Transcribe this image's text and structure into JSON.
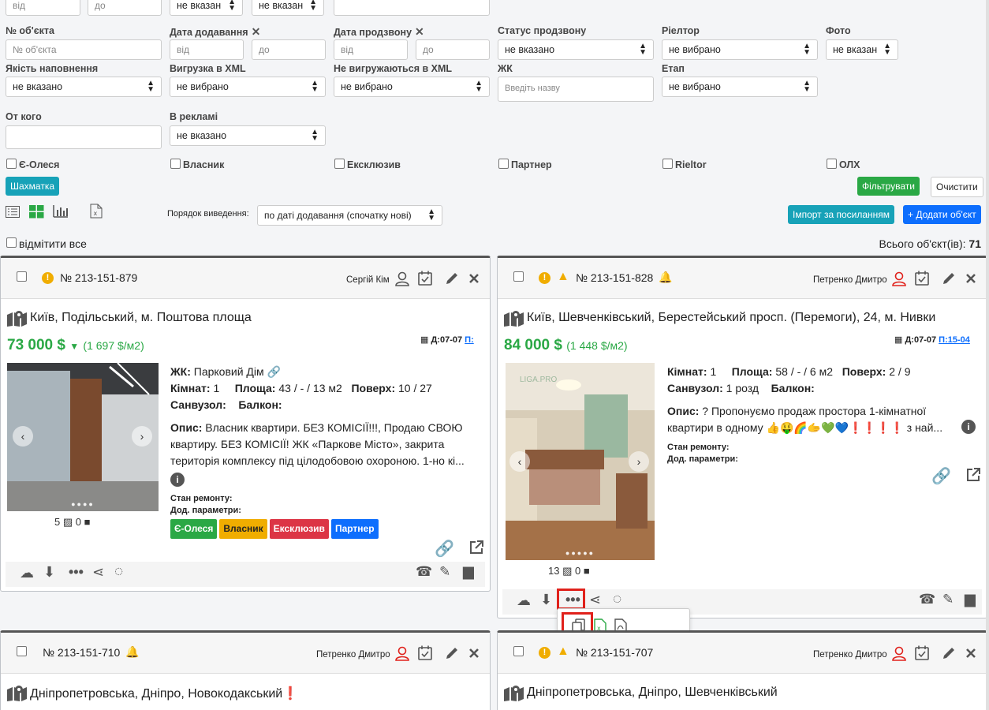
{
  "filters": {
    "row0": {
      "from": "від",
      "to": "до",
      "sel1": "не вказан",
      "sel2": "не вказан"
    },
    "labels": {
      "object_no": "№ об'єкта",
      "date_added": "Дата додавання",
      "date_call": "Дата продзвону",
      "call_status": "Статус продзвону",
      "realtor": "Ріелтор",
      "photo": "Фото",
      "quality": "Якість наповнення",
      "xml_export": "Вигрузка в XML",
      "no_xml": "Не вигружаються в XML",
      "complex": "ЖК",
      "stage": "Етап",
      "from_whom": "От кого",
      "in_ads": "В рекламі"
    },
    "placeholders": {
      "object_no": "№ об'єкта",
      "from": "від",
      "to": "до",
      "complex": "Введіть назву"
    },
    "values": {
      "call_status": "не вказано",
      "realtor": "не вибрано",
      "photo": "не вказан",
      "quality": "не вказано",
      "xml_export": "не вибрано",
      "no_xml": "не вибрано",
      "stage": "не вибрано",
      "in_ads": "не вказано"
    },
    "checkboxes": [
      "Є-Олеся",
      "Власник",
      "Ексклюзив",
      "Партнер",
      "Rieltor",
      "ОЛХ"
    ],
    "chess_btn": "Шахматка",
    "filter_btn": "Фільтрувати",
    "clear_btn": "Очистити"
  },
  "toolbar": {
    "order_label": "Порядок виведення:",
    "order_value": "по даті додавання (спочатку нові)",
    "import_btn": "Імпорт за посиланням",
    "add_btn": "+ Додати об'єкт",
    "mark_all": "відмітити все",
    "total_label": "Всього об'єкт(ів):",
    "total_value": "71"
  },
  "cards": [
    {
      "number": "№ 213-151-879",
      "agent": "Сергій Кім",
      "address": "Київ, Подільський, м. Поштова площа",
      "price": "73 000 $",
      "price_m2": "(1 697 $/м2)",
      "date": "Д:07-07",
      "p_link": "П:",
      "complex_label": "ЖК:",
      "complex": "Парковий Дім",
      "rooms_label": "Кімнат:",
      "rooms": "1",
      "area_label": "Площа:",
      "area": "43 / - / 13 м2",
      "floor_label": "Поверх:",
      "floor": "10 / 27",
      "bath_label": "Санвузол:",
      "balcony_label": "Балкон:",
      "desc_label": "Опис:",
      "desc": "Власник квартири. БЕЗ КОМІСІЇ!!!, Продаю СВОЮ квартиру. БЕЗ КОМІСІЇ! ЖК «Паркове Місто», закрита територія комплексу під цілодобовою охороною. 1-но кі...",
      "repair_label": "Стан ремонту:",
      "params_label": "Дод. параметри:",
      "photos": "5",
      "videos": "0",
      "tags": [
        "Є-Олеся",
        "Власник",
        "Ексклюзив",
        "Партнер"
      ]
    },
    {
      "number": "№ 213-151-828",
      "agent": "Петренко Дмитро",
      "address": "Київ, Шевченківський, Берестейський просп. (Перемоги), 24, м. Нивки",
      "price": "84 000 $",
      "price_m2": "(1 448 $/м2)",
      "date": "Д:07-07",
      "p_link": "П:15-04",
      "rooms_label": "Кімнат:",
      "rooms": "1",
      "area_label": "Площа:",
      "area": "58 / - / 6 м2",
      "floor_label": "Поверх:",
      "floor": "2 / 9",
      "bath_label": "Санвузол:",
      "bath": "1 розд",
      "balcony_label": "Балкон:",
      "desc_label": "Опис:",
      "desc": "? Пропонуємо продаж простора 1-кімнатної квартири в одному 👍🤑🌈🫱💚💙❗❗❗❗ з най...",
      "repair_label": "Стан ремонту:",
      "params_label": "Дод. параметри:",
      "photos": "13",
      "videos": "0",
      "watermark": "LIGA.PRO"
    },
    {
      "number": "№ 213-151-710",
      "agent": "Петренко Дмитро",
      "address": "Дніпропетровська, Дніпро, Новокодакський❗"
    },
    {
      "number": "№ 213-151-707",
      "agent": "Петренко Дмитро",
      "address": "Дніпропетровська, Дніпро, Шевченківський"
    }
  ],
  "colors": {
    "green": "#2aa845",
    "teal": "#17a2b8",
    "blue": "#0d6efd",
    "orange": "#f0ad00",
    "red": "#dc3545"
  }
}
